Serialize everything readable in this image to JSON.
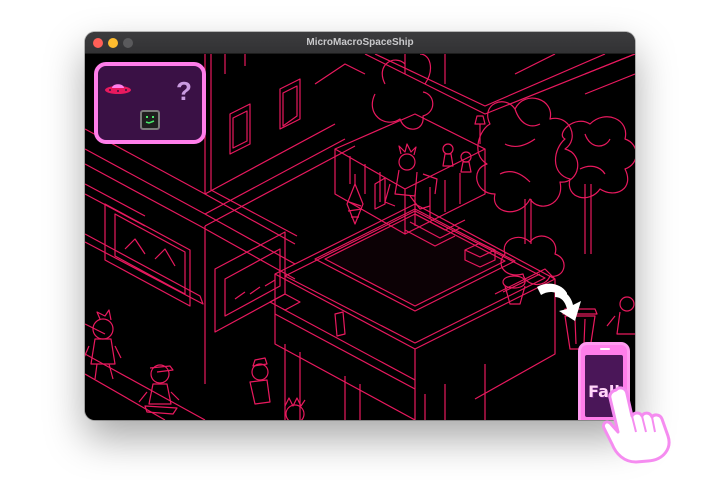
{
  "window": {
    "title": "MicroMacroSpaceShip"
  },
  "inventory": {
    "unknown_item": "?",
    "items": [
      "ufo-icon",
      "robot-face-icon",
      "question-mark-icon"
    ]
  },
  "fall_button": {
    "label": "Fall"
  },
  "hint": {
    "arrow_icon": "curved-arrow-icon",
    "pointer_icon": "pointing-hand-icon"
  },
  "colors": {
    "line_art": "#e8195e",
    "background": "#000000",
    "inventory_panel": "#3a1145",
    "accent_pink": "#ff7eea"
  }
}
